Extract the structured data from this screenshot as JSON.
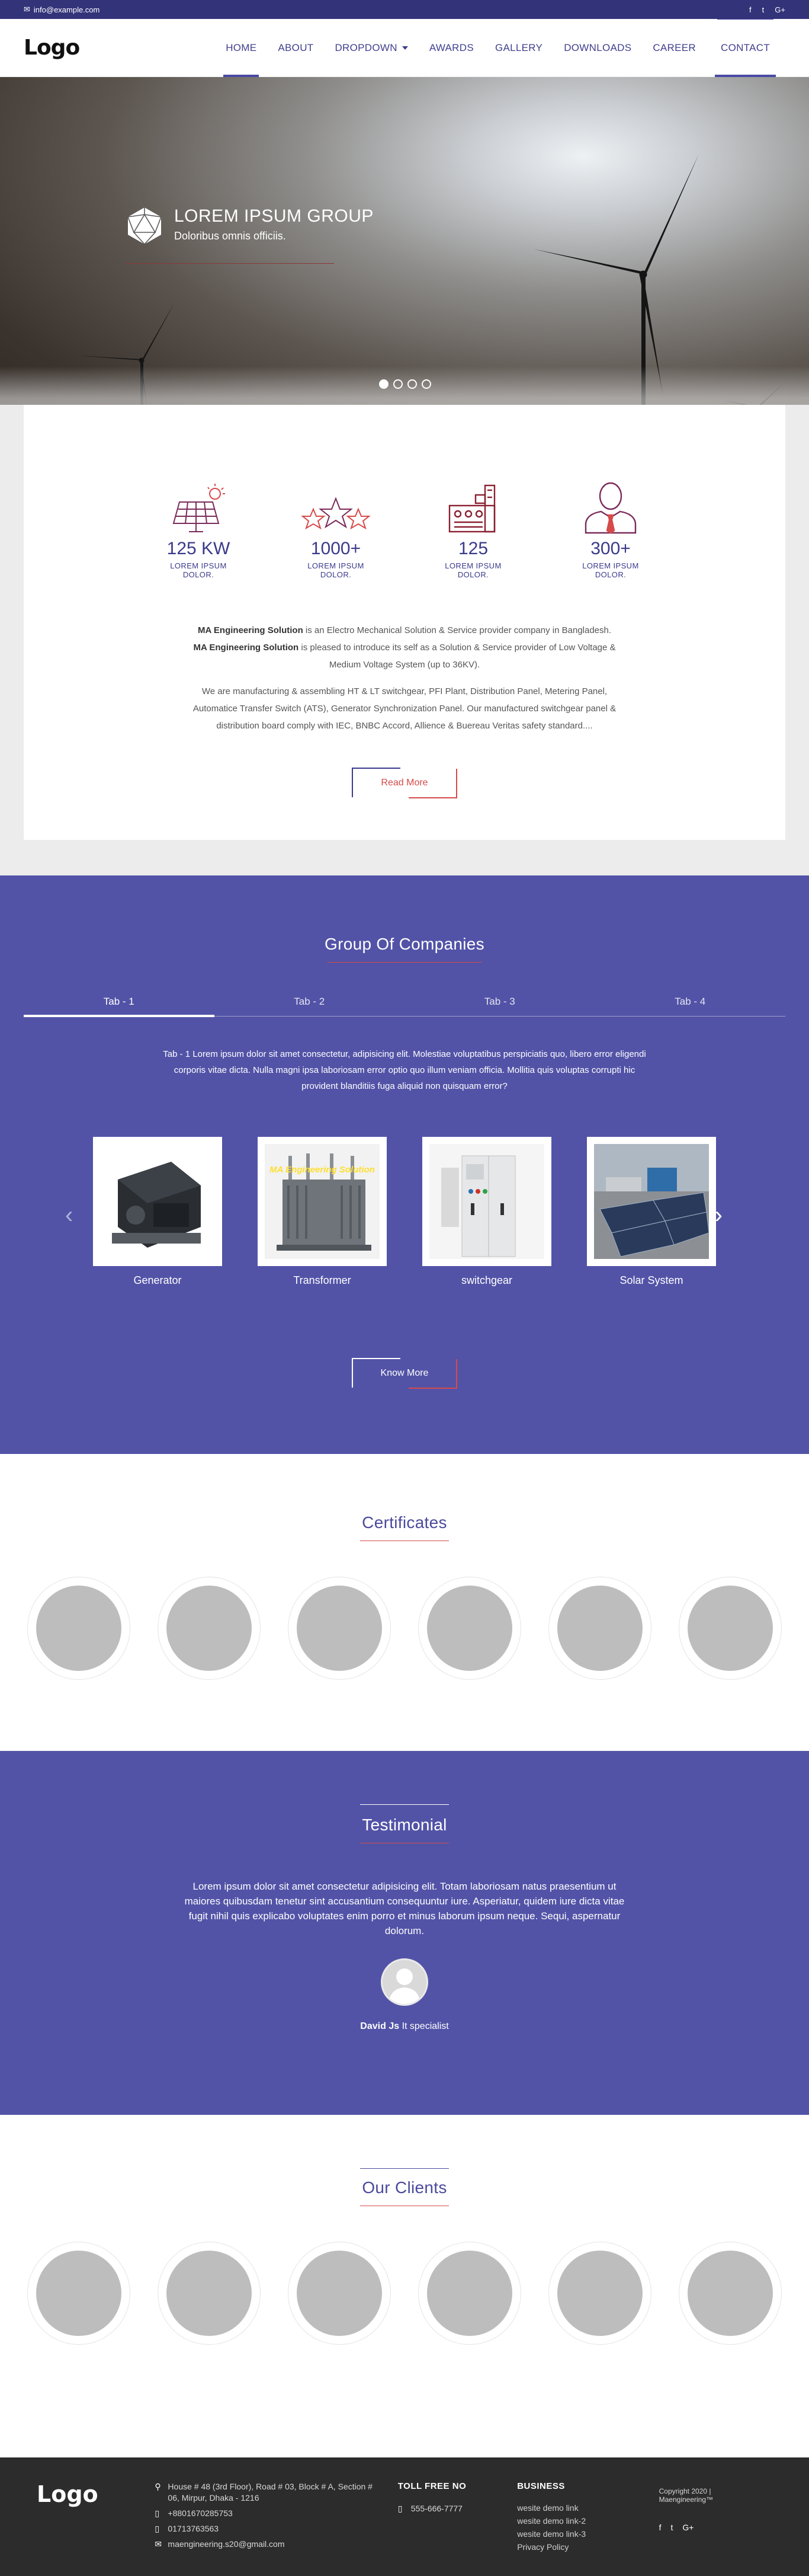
{
  "topbar": {
    "email": "info@example.com",
    "socials": [
      "f",
      "t",
      "G+"
    ]
  },
  "nav": {
    "logo": "Logo",
    "items": [
      "HOME",
      "ABOUT",
      "DROPDOWN",
      "AWARDS",
      "GALLERY",
      "DOWNLOADS",
      "CAREER",
      "CONTACT"
    ],
    "active": "HOME"
  },
  "hero": {
    "title": "LOREM IPSUM GROUP",
    "subtitle": "Doloribus omnis officiis."
  },
  "stats": [
    {
      "icon": "solar-panel-icon",
      "value": "125 KW",
      "label": "LOREM IPSUM DOLOR."
    },
    {
      "icon": "stars-icon",
      "value": "1000+",
      "label": "LOREM IPSUM DOLOR."
    },
    {
      "icon": "factory-icon",
      "value": "125",
      "label": "LOREM IPSUM DOLOR."
    },
    {
      "icon": "person-icon",
      "value": "300+",
      "label": "LOREM IPSUM DOLOR."
    }
  ],
  "about": {
    "p1_bold1": "MA Engineering Solution",
    "p1_text1": " is an Electro Mechanical Solution & Service provider company in Bangladesh. ",
    "p1_bold2": "MA Engineering Solution",
    "p1_text2": " is pleased to introduce its self as a Solution & Service provider of Low Voltage & Medium Voltage System (up to 36KV).",
    "p2": "We are manufacturing & assembling HT & LT switchgear, PFI Plant, Distribution Panel, Metering Panel, Automatice Transfer Switch (ATS), Generator Synchronization Panel. Our manufactured switchgear panel & distribution board comply with IEC, BNBC Accord, Allience & Buereau Veritas safety standard....",
    "button": "Read More"
  },
  "group": {
    "title": "Group Of Companies",
    "tabs": [
      "Tab - 1",
      "Tab - 2",
      "Tab - 3",
      "Tab - 4"
    ],
    "tab_text": "Tab - 1 Lorem ipsum dolor sit amet consectetur, adipisicing elit. Molestiae voluptatibus perspiciatis quo, libero error eligendi corporis vitae dicta. Nulla magni ipsa laboriosam error optio quo illum veniam officia. Mollitia quis voluptas corrupti hic provident blanditiis fuga aliquid non quisquam error?",
    "products": [
      {
        "name": "Generator"
      },
      {
        "name": "Transformer",
        "overlay": "MA Engineering Solution"
      },
      {
        "name": "switchgear"
      },
      {
        "name": "Solar System"
      }
    ],
    "button": "Know More"
  },
  "certificates": {
    "title": "Certificates"
  },
  "testimonial": {
    "title": "Testimonial",
    "quote": "Lorem ipsum dolor sit amet consectetur adipisicing elit. Totam laboriosam natus praesentium ut maiores quibusdam tenetur sint accusantium consequuntur iure. Asperiatur, quidem iure dicta vitae fugit nihil quis explicabo voluptates enim porro et minus laborum ipsum neque. Sequi, aspernatur dolorum.",
    "name": "David Js",
    "role": "It specialist"
  },
  "clients": {
    "title": "Our Clients"
  },
  "footer": {
    "logo": "Logo",
    "address": "House # 48 (3rd Floor), Road # 03, Block # A, Section # 06, Mirpur, Dhaka - 1216",
    "phone1": "+8801670285753",
    "phone2": "01713763563",
    "email": "maengineering.s20@gmail.com",
    "toll_title": "TOLL FREE NO",
    "toll": "555-666-7777",
    "biz_title": "BUSINESS",
    "links": [
      "wesite demo link",
      "wesite demo link-2",
      "wesite demo link-3",
      "Privacy Policy"
    ],
    "copyright": "Copyright 2020 | Maengineering™",
    "socials": [
      "f",
      "t",
      "G+"
    ]
  }
}
